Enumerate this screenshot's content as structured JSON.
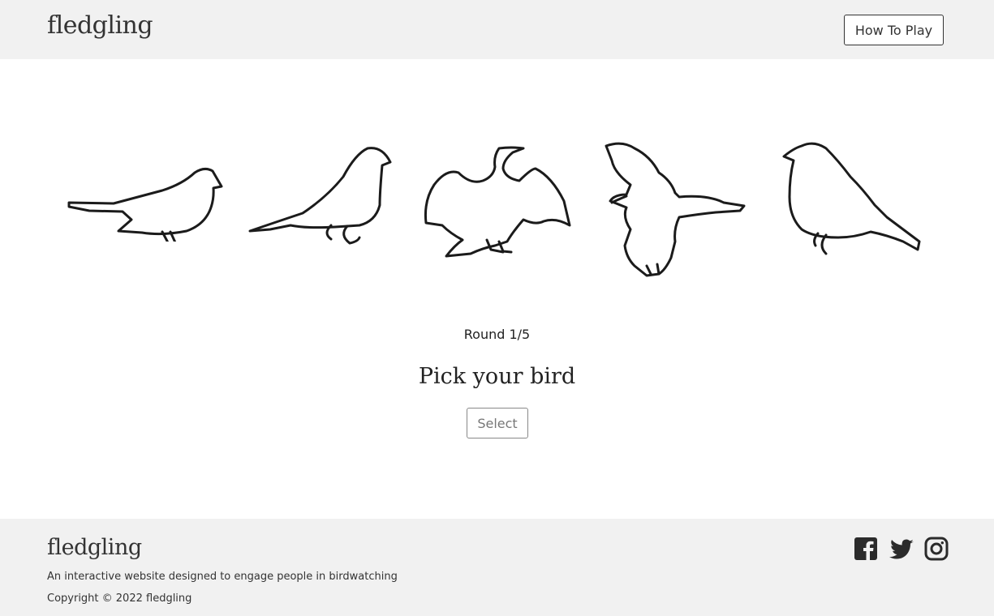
{
  "header": {
    "logo": "fledgling",
    "how_to_play_label": "How To Play"
  },
  "game": {
    "birds": [
      {
        "name": "bird-option-1"
      },
      {
        "name": "bird-option-2"
      },
      {
        "name": "bird-option-3"
      },
      {
        "name": "bird-option-4"
      },
      {
        "name": "bird-option-5"
      }
    ],
    "round_text": "Round 1/5",
    "prompt": "Pick your bird",
    "select_label": "Select"
  },
  "footer": {
    "logo": "fledgling",
    "tagline": "An interactive website designed to engage people in birdwatching",
    "copyright": "Copyright © 2022 fledgling",
    "social": [
      "facebook-icon",
      "twitter-icon",
      "instagram-icon"
    ]
  },
  "colors": {
    "header_bg": "#f1f1f1",
    "footer_bg": "#f1f1f1",
    "text": "#222222"
  }
}
